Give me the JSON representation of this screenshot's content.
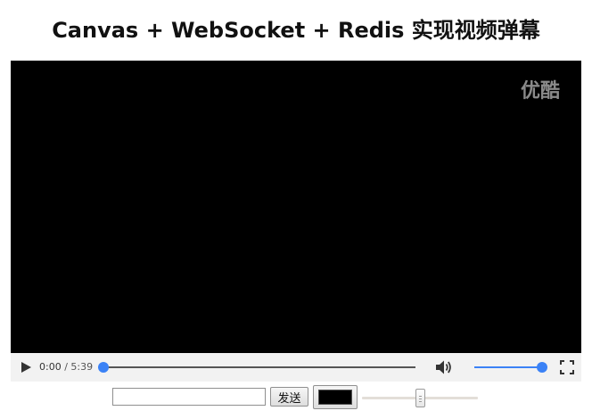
{
  "page": {
    "title": "Canvas + WebSocket + Redis 实现视频弹幕"
  },
  "video": {
    "watermark": "优酷",
    "background_color": "#000000"
  },
  "controls": {
    "play_icon": "play-icon",
    "current_time": "0:00",
    "separator": "/",
    "duration": "5:39",
    "progress_fraction": 0.0,
    "volume_icon": "speaker-icon",
    "volume_fraction": 1.0,
    "fullscreen_icon": "fullscreen-icon",
    "accent_color": "#3b82f6"
  },
  "danmu_form": {
    "input_value": "",
    "input_placeholder": "",
    "send_label": "发送",
    "color_value": "#000000",
    "range_fraction": 0.5
  }
}
